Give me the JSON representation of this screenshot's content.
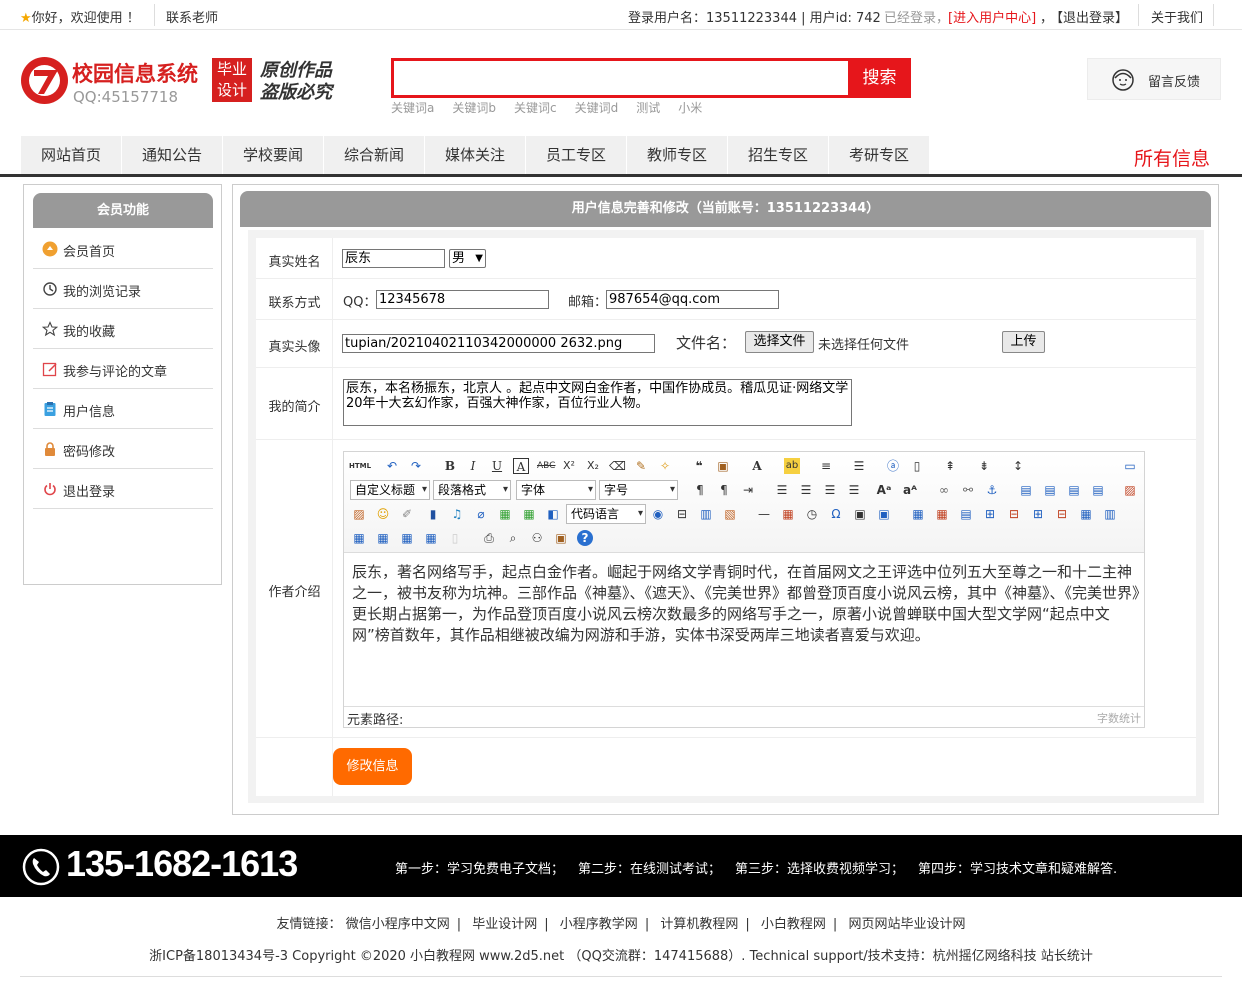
{
  "topbar": {
    "welcome": "你好，欢迎使用 ！",
    "contact": "联系老师",
    "login_user": "登录用户名：13511223344 | 用户id: 742",
    "logged_in": "已经登录，",
    "user_center": "[进入用户中心]",
    "comma": "，",
    "logout": "【退出登录】",
    "about": "关于我们"
  },
  "header": {
    "title": "校园信息系统",
    "qq": "QQ:45157718",
    "badge_line1": "毕业",
    "badge_line2": "设计",
    "slogan_line1": "原创作品",
    "slogan_line2": "盗版必究",
    "search_placeholder": "",
    "search_button": "搜索",
    "keywords": [
      "关键词a",
      "关键词b",
      "关键词c",
      "关键词d",
      "测试",
      "小米"
    ],
    "feedback": "留言反馈"
  },
  "nav": {
    "items": [
      "网站首页",
      "通知公告",
      "学校要闻",
      "综合新闻",
      "媒体关注",
      "员工专区",
      "教师专区",
      "招生专区",
      "考研专区"
    ],
    "all_info": "所有信息"
  },
  "sidebar": {
    "title": "会员功能",
    "items": [
      {
        "label": "会员首页",
        "icon": "home-icon"
      },
      {
        "label": "我的浏览记录",
        "icon": "history-icon"
      },
      {
        "label": "我的收藏",
        "icon": "star-icon"
      },
      {
        "label": "我参与评论的文章",
        "icon": "edit-icon"
      },
      {
        "label": "用户信息",
        "icon": "clipboard-icon"
      },
      {
        "label": "密码修改",
        "icon": "lock-icon"
      },
      {
        "label": "退出登录",
        "icon": "power-icon"
      }
    ]
  },
  "main": {
    "title": "用户信息完善和修改（当前账号：13511223344）",
    "labels": {
      "name": "真实姓名",
      "contact": "联系方式",
      "avatar": "真实头像",
      "intro": "我的简介",
      "author": "作者介绍"
    },
    "name_value": "辰东",
    "gender": "男",
    "qq_label": "QQ：",
    "qq_value": "12345678",
    "email_label": "邮箱：",
    "email_value": "987654@qq.com",
    "avatar_value": "tupian/20210402110342000000 2632.png",
    "file_label": "文件名：",
    "choose_file": "选择文件",
    "no_file": "未选择任何文件",
    "upload": "上传",
    "intro_value": "辰东，本名杨振东，北京人 。起点中文网白金作者，中国作协成员。稽瓜见证·网络文学20年十大玄幻作家，百强大神作家，百位行业人物。",
    "editor": {
      "html_btn": "HTML",
      "custom_title": "自定义标题",
      "paragraph": "段落格式",
      "font": "字体",
      "size": "字号",
      "code_lang": "代码语言",
      "content": "辰东，著名网络写手，起点白金作者。崛起于网络文学青铜时代，在首届网文之王评选中位列五大至尊之一和十二主神之一，被书友称为坑神。三部作品《神墓》、《遮天》、《完美世界》都曾登顶百度小说风云榜，其中《神墓》、《完美世界》更长期占据第一，为作品登顶百度小说风云榜次数最多的网络写手之一，原著小说曾蝉联中国大型文学网“起点中文网”榜首数年，其作品相继被改编为网游和手游，实体书深受两岸三地读者喜爱与欢迎。",
      "path_label": "元素路径:",
      "word_count": "字数统计"
    },
    "submit": "修改信息"
  },
  "footer": {
    "phone": "135-1682-1613",
    "steps": [
      "第一步：学习免费电子文档；",
      "第二步：在线测试考试；",
      "第三步：选择收费视频学习；",
      "第四步：学习技术文章和疑难解答."
    ],
    "links_label": "友情链接：",
    "links": [
      "微信小程序中文网",
      "毕业设计网",
      "小程序教学网",
      "计算机教程网",
      "小白教程网",
      "网页网站毕业设计网"
    ],
    "icp": "浙ICP备18013434号-3 Copyright ©2020 小白教程网 www.2d5.net （QQ交流群：147415688）. Technical support/技术支持：杭州摇亿网络科技 站长统计"
  },
  "colors": {
    "accent_red": "#e6161b",
    "orange": "#ff6a00",
    "header_gray": "#999999"
  }
}
